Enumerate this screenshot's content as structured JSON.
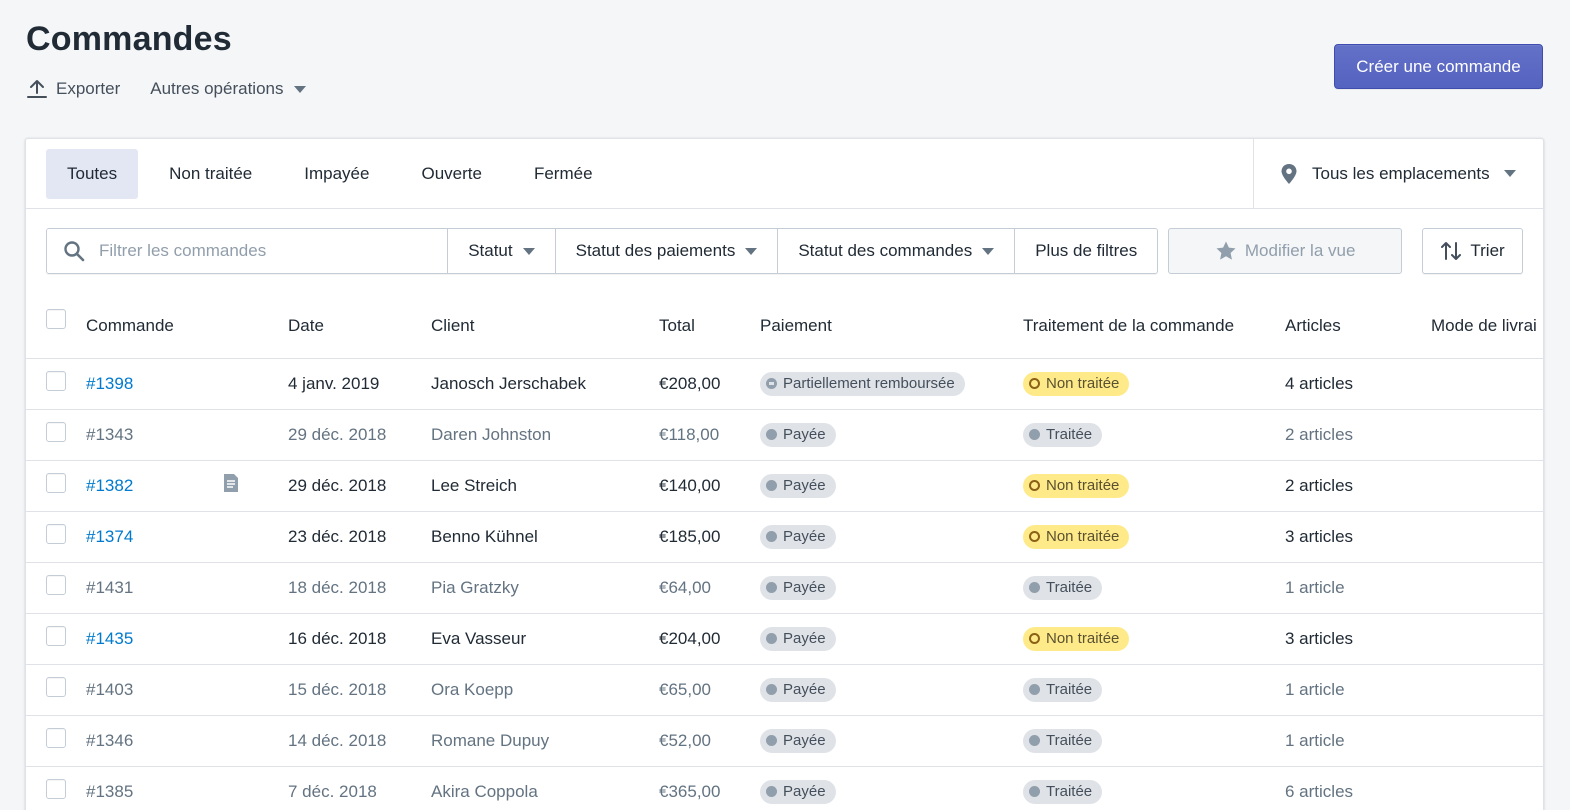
{
  "page": {
    "title": "Commandes",
    "export_label": "Exporter",
    "more_actions_label": "Autres opérations",
    "create_button": "Créer une commande"
  },
  "tabs": [
    {
      "label": "Toutes",
      "active": true
    },
    {
      "label": "Non traitée",
      "active": false
    },
    {
      "label": "Impayée",
      "active": false
    },
    {
      "label": "Ouverte",
      "active": false
    },
    {
      "label": "Fermée",
      "active": false
    }
  ],
  "location": {
    "label": "Tous les emplacements"
  },
  "filters": {
    "search_placeholder": "Filtrer les commandes",
    "status": "Statut",
    "payment_status": "Statut des paiements",
    "order_status": "Statut des commandes",
    "more_filters": "Plus de filtres",
    "edit_view": "Modifier la vue",
    "sort": "Trier"
  },
  "table": {
    "columns": [
      "Commande",
      "Date",
      "Client",
      "Total",
      "Paiement",
      "Traitement de la commande",
      "Articles",
      "Mode de livrai"
    ],
    "rows": [
      {
        "order": "#1398",
        "date": "4 janv. 2019",
        "client": "Janosch Jerschabek",
        "total": "€208,00",
        "payment": "Partiellement remboursée",
        "fulfillment": "Non traitée",
        "items": "4 articles",
        "note": false
      },
      {
        "order": "#1343",
        "date": "29 déc. 2018",
        "client": "Daren Johnston",
        "total": "€118,00",
        "payment": "Payée",
        "fulfillment": "Traitée",
        "items": "2 articles",
        "note": false
      },
      {
        "order": "#1382",
        "date": "29 déc. 2018",
        "client": "Lee Streich",
        "total": "€140,00",
        "payment": "Payée",
        "fulfillment": "Non traitée",
        "items": "2 articles",
        "note": true
      },
      {
        "order": "#1374",
        "date": "23 déc. 2018",
        "client": "Benno Kühnel",
        "total": "€185,00",
        "payment": "Payée",
        "fulfillment": "Non traitée",
        "items": "3 articles",
        "note": false
      },
      {
        "order": "#1431",
        "date": "18 déc. 2018",
        "client": "Pia Gratzky",
        "total": "€64,00",
        "payment": "Payée",
        "fulfillment": "Traitée",
        "items": "1 article",
        "note": false
      },
      {
        "order": "#1435",
        "date": "16 déc. 2018",
        "client": "Eva Vasseur",
        "total": "€204,00",
        "payment": "Payée",
        "fulfillment": "Non traitée",
        "items": "3 articles",
        "note": false
      },
      {
        "order": "#1403",
        "date": "15 déc. 2018",
        "client": "Ora Koepp",
        "total": "€65,00",
        "payment": "Payée",
        "fulfillment": "Traitée",
        "items": "1 article",
        "note": false
      },
      {
        "order": "#1346",
        "date": "14 déc. 2018",
        "client": "Romane Dupuy",
        "total": "€52,00",
        "payment": "Payée",
        "fulfillment": "Traitée",
        "items": "1 article",
        "note": false
      },
      {
        "order": "#1385",
        "date": "7 déc. 2018",
        "client": "Akira Coppola",
        "total": "€365,00",
        "payment": "Payée",
        "fulfillment": "Traitée",
        "items": "6 articles",
        "note": false
      }
    ]
  },
  "colors": {
    "primary": "#5c6ac4",
    "link": "#007ace",
    "unfulfilled_badge": "#ffea8a",
    "neutral_badge": "#dfe3e8"
  }
}
